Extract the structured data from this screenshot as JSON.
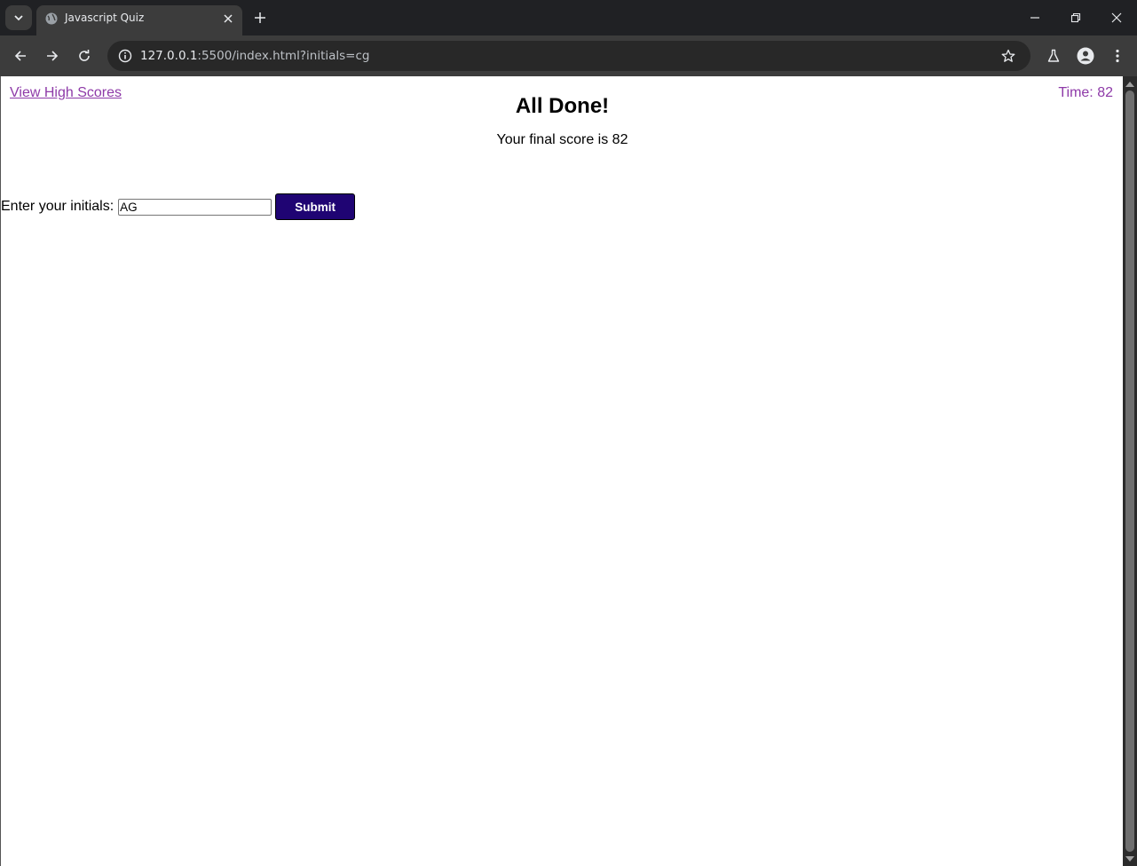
{
  "browser": {
    "tab_title": "Javascript Quiz",
    "url_host": "127.0.0.1",
    "url_rest": ":5500/index.html?initials=cg",
    "icons": {
      "tab_search": "chevron-down-icon",
      "favicon": "globe-icon",
      "tab_close": "close-icon",
      "new_tab": "plus-icon",
      "back": "arrow-left-icon",
      "forward": "arrow-right-icon",
      "reload": "reload-icon",
      "site_info": "info-icon",
      "bookmark": "star-icon",
      "labs": "flask-icon",
      "profile": "person-icon",
      "menu": "kebab-menu-icon"
    }
  },
  "page": {
    "high_scores_link": "View High Scores",
    "timer_label": "Time: 82",
    "title": "All Done!",
    "final_score_text": "Your final score is 82",
    "initials_label": "Enter your initials:",
    "initials_value": "AG",
    "submit_label": "Submit"
  },
  "colors": {
    "link_purple": "#8e3aa8",
    "submit_bg": "#1f0473",
    "browser_dark": "#202124",
    "toolbar": "#3c3c3c"
  }
}
